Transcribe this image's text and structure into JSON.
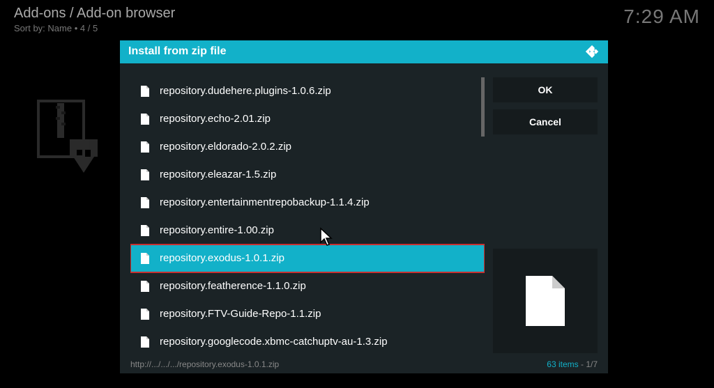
{
  "header": {
    "breadcrumb": "Add-ons / Add-on browser",
    "sort_label": "Sort by: Name",
    "sort_sep": "•",
    "page_pos": "4 / 5",
    "clock": "7:29 AM"
  },
  "dialog": {
    "title": "Install from zip file",
    "files": [
      "repository.dudehere.plugins-1.0.6.zip",
      "repository.echo-2.01.zip",
      "repository.eldorado-2.0.2.zip",
      "repository.eleazar-1.5.zip",
      "repository.entertainmentrepobackup-1.1.4.zip",
      "repository.entire-1.00.zip",
      "repository.exodus-1.0.1.zip",
      "repository.featherence-1.1.0.zip",
      "repository.FTV-Guide-Repo-1.1.zip",
      "repository.googlecode.xbmc-catchuptv-au-1.3.zip"
    ],
    "selected_index": 6,
    "buttons": {
      "ok": "OK",
      "cancel": "Cancel"
    },
    "footer_path": "http://.../.../.../repository.exodus-1.0.1.zip",
    "footer_count": "63 items",
    "footer_page": "1/7"
  }
}
